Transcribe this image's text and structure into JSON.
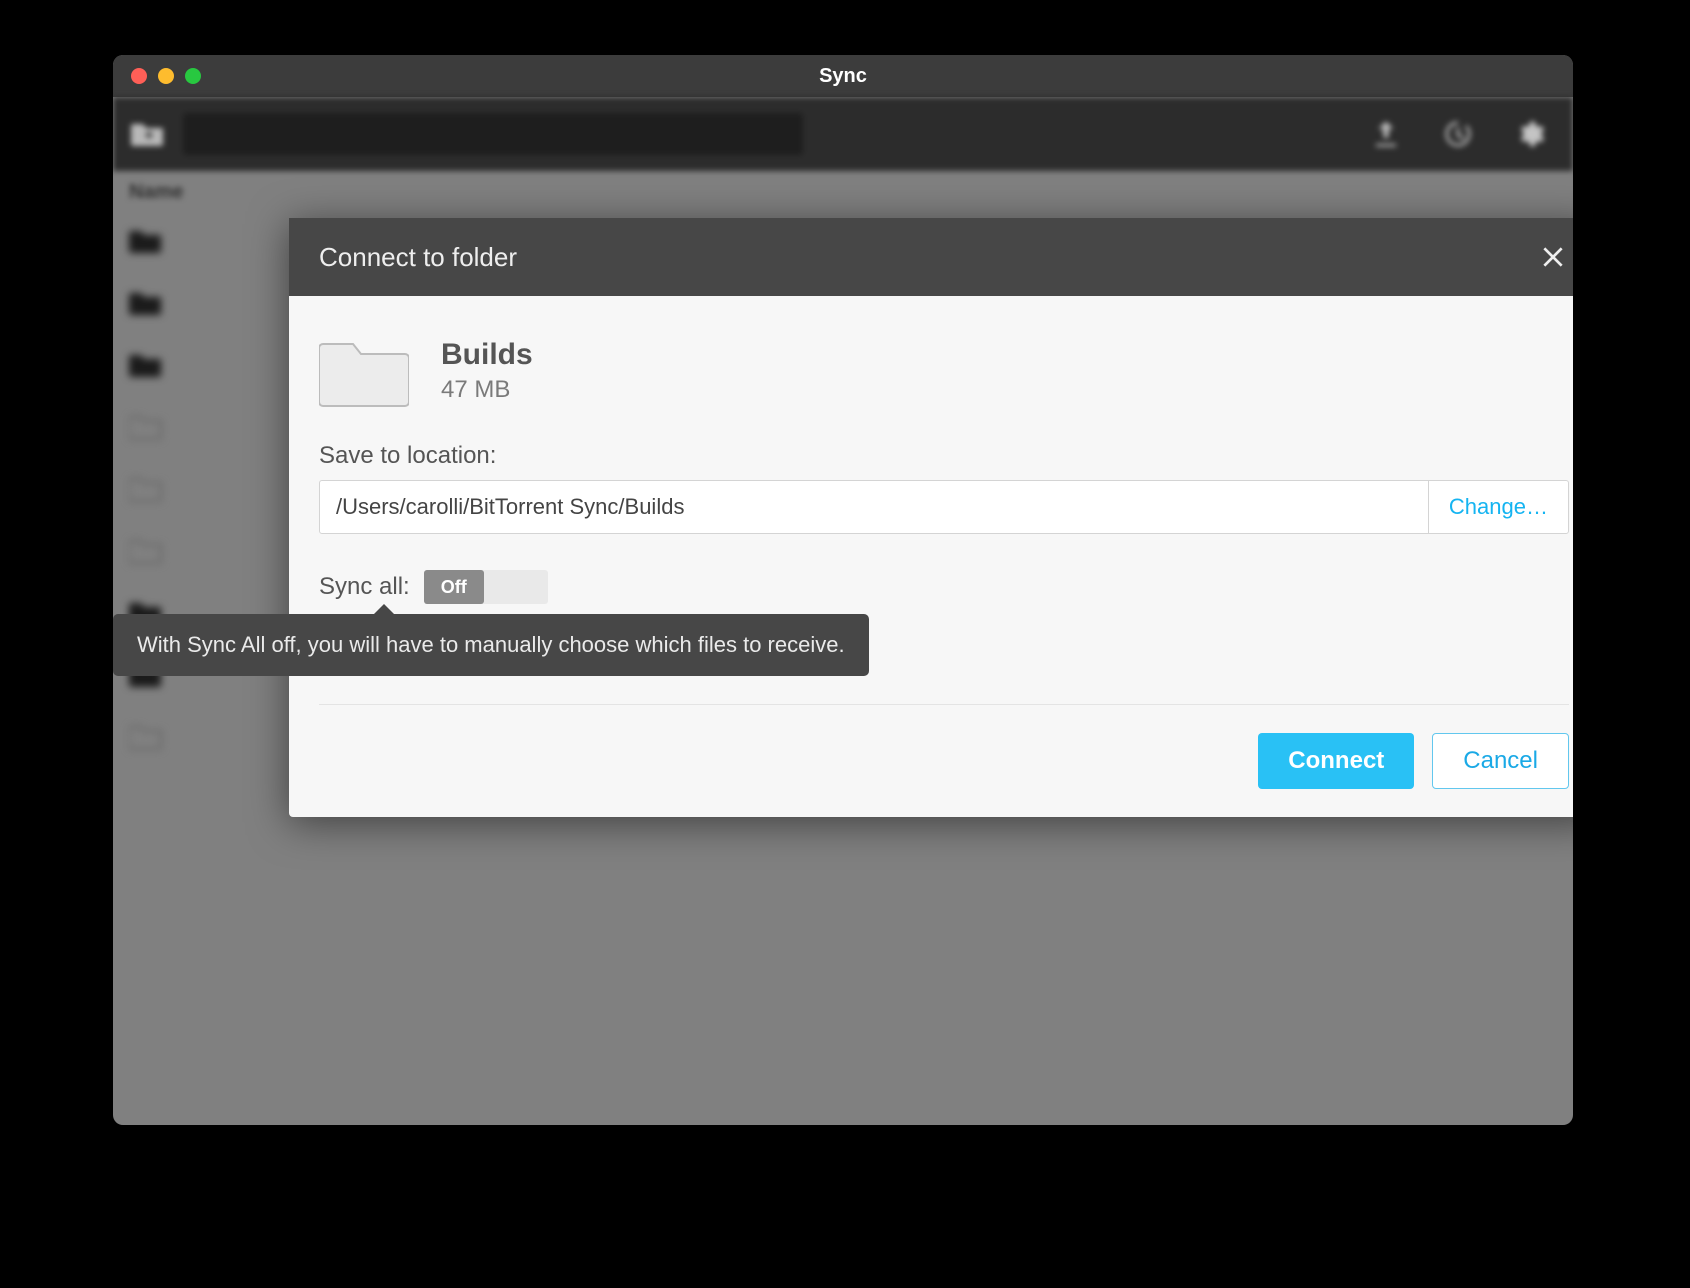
{
  "window": {
    "title": "Sync"
  },
  "columns": {
    "name": "Name"
  },
  "dialog": {
    "title": "Connect to folder",
    "folder_name": "Builds",
    "folder_size": "47 MB",
    "location_label": "Save to location:",
    "location_value": "/Users/carolli/BitTorrent Sync/Builds",
    "change_label": "Change…",
    "syncall_label": "Sync all:",
    "toggle_state": "Off",
    "tooltip": "With Sync All off, you will have to manually choose which files to receive.",
    "connect_label": "Connect",
    "cancel_label": "Cancel"
  }
}
